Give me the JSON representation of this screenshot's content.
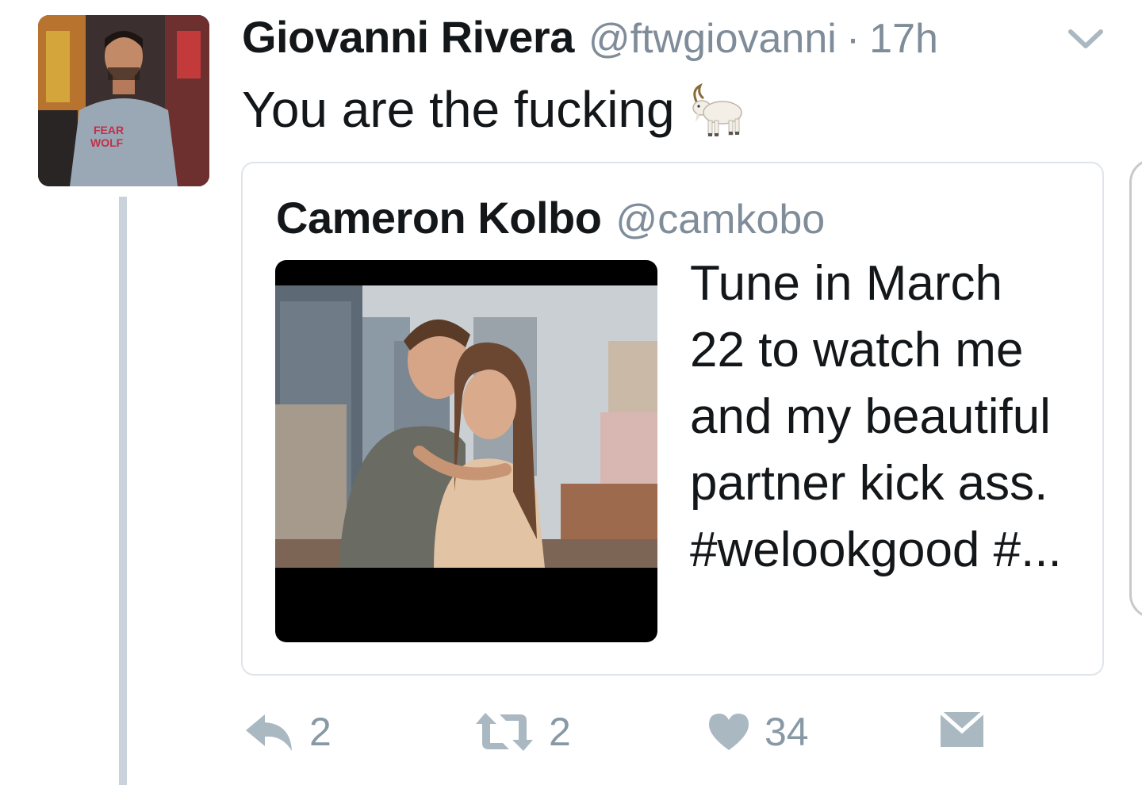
{
  "tweet": {
    "author": {
      "display_name": "Giovanni Rivera",
      "handle": "@ftwgiovanni",
      "separator": "·",
      "time": "17h"
    },
    "text": "You are the fucking",
    "emoji": "goat-emoji"
  },
  "quoted_tweet": {
    "display_name": "Cameron Kolbo",
    "handle": "@camkobo",
    "lines": [
      "Tune in March",
      "22 to watch me",
      "and my beautiful",
      "partner kick ass.",
      "#welookgood #..."
    ]
  },
  "actions": {
    "reply_count": "2",
    "retweet_count": "2",
    "like_count": "34"
  },
  "icons": {
    "caret": "chevron-down-icon",
    "reply": "reply-icon",
    "retweet": "retweet-icon",
    "like": "heart-icon",
    "dm": "envelope-icon"
  },
  "colors": {
    "primary_text": "#14171a",
    "secondary_text": "#7f8c99",
    "icon": "#aab8c2",
    "border": "#dfe4e9",
    "thread_line": "#cad3dc"
  }
}
